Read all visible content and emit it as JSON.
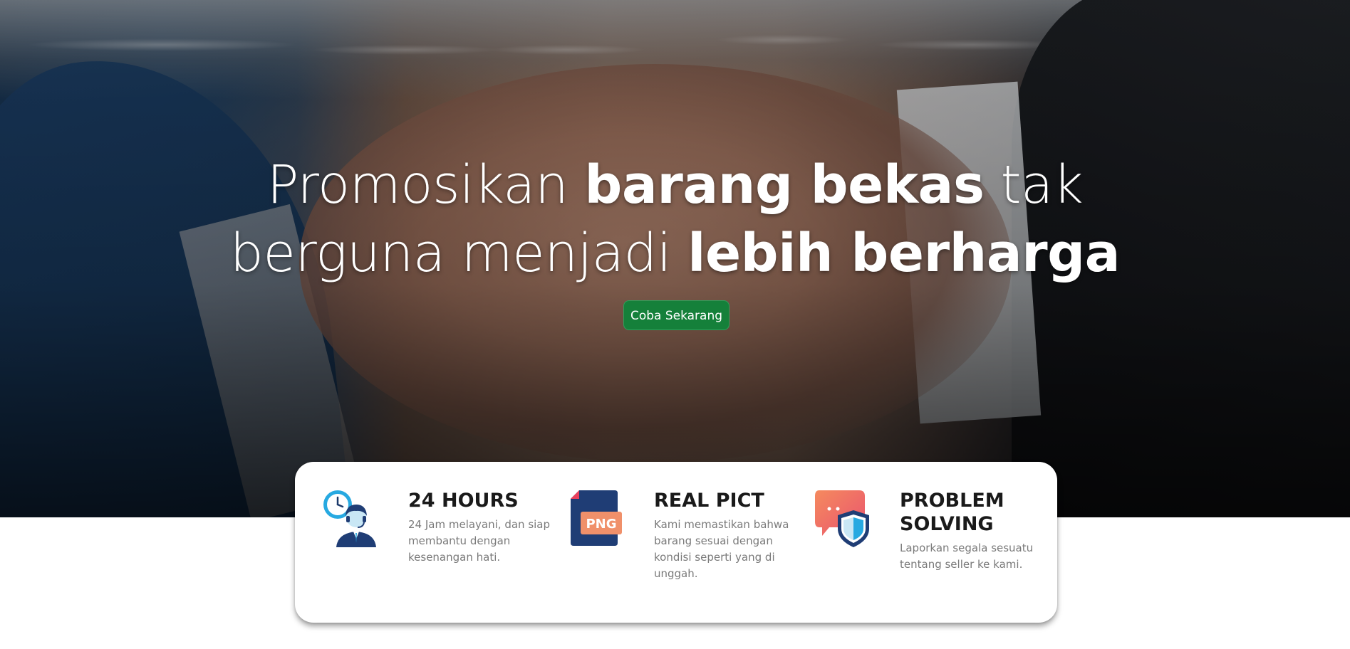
{
  "hero": {
    "headline_line1_light": "Promosikan ",
    "headline_line1_bold": "barang bekas",
    "headline_line1_tail": " tak",
    "headline_line2_light": "berguna menjadi ",
    "headline_line2_bold": "lebih berharga",
    "cta_label": "Coba Sekarang",
    "cta_color": "#15803a"
  },
  "features": [
    {
      "icon": "customer-service-icon",
      "title": "24 HOURS",
      "description": "24 Jam melayani, dan siap membantu dengan kesenangan hati."
    },
    {
      "icon": "png-file-icon",
      "icon_text": "PNG",
      "title": "REAL PICT",
      "description": "Kami memastikan bahwa barang sesuai dengan kondisi seperti yang di unggah."
    },
    {
      "icon": "shield-chat-icon",
      "title": "PROBLEM SOLVING",
      "description": "Laporkan segala sesuatu tentang seller ke kami."
    }
  ]
}
